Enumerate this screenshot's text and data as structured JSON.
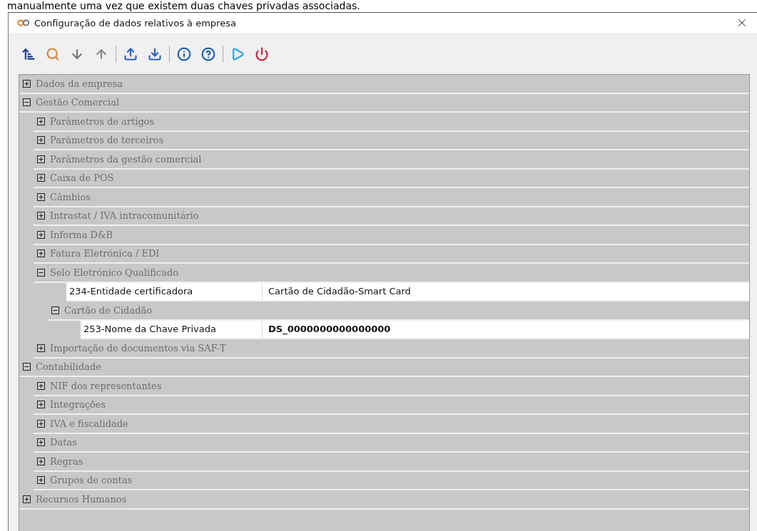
{
  "caption": "manualmente uma vez que existem duas chaves privadas associadas.",
  "window": {
    "title": "Configuração de dados relativos à empresa"
  },
  "toolbar": [
    {
      "kind": "sort"
    },
    {
      "kind": "search"
    },
    {
      "kind": "down"
    },
    {
      "kind": "up"
    },
    {
      "kind": "separator"
    },
    {
      "kind": "export"
    },
    {
      "kind": "import"
    },
    {
      "kind": "separator"
    },
    {
      "kind": "info"
    },
    {
      "kind": "help"
    },
    {
      "kind": "separator"
    },
    {
      "kind": "run"
    },
    {
      "kind": "power"
    }
  ],
  "tree": [
    {
      "kind": "group",
      "label": "Dados da empresa",
      "expanded": false
    },
    {
      "kind": "group",
      "label": "Gestão Comercial",
      "expanded": true,
      "children": [
        {
          "kind": "group",
          "label": "Parâmetros de artigos",
          "expanded": false
        },
        {
          "kind": "group",
          "label": "Parâmetros de terceiros",
          "expanded": false
        },
        {
          "kind": "group",
          "label": "Parâmetros da gestão comercial",
          "expanded": false
        },
        {
          "kind": "group",
          "label": "Caixa de POS",
          "expanded": false
        },
        {
          "kind": "group",
          "label": "Câmbios",
          "expanded": false
        },
        {
          "kind": "group",
          "label": "Intrastat / IVA intracomunitário",
          "expanded": false
        },
        {
          "kind": "group",
          "label": "Informa D&B",
          "expanded": false
        },
        {
          "kind": "group",
          "label": "Fatura Eletrónica / EDI",
          "expanded": false
        },
        {
          "kind": "group",
          "label": "Selo Eletrónico Qualificado",
          "expanded": true,
          "children": [
            {
              "kind": "property",
              "label": "234-Entidade certificadora",
              "value": "Cartão de Cidadão-Smart Card",
              "emphasis": false
            },
            {
              "kind": "group",
              "label": "Cartão de Cidadão",
              "expanded": true,
              "children": [
                {
                  "kind": "property",
                  "label": "253-Nome da Chave Privada",
                  "value": "DS_0000000000000000",
                  "emphasis": true
                }
              ]
            }
          ]
        },
        {
          "kind": "group",
          "label": "Importação de documentos via SAF-T",
          "expanded": false
        }
      ]
    },
    {
      "kind": "group",
      "label": "Contabilidade",
      "expanded": true,
      "children": [
        {
          "kind": "group",
          "label": "NIF dos representantes",
          "expanded": false
        },
        {
          "kind": "group",
          "label": "Integrações",
          "expanded": false
        },
        {
          "kind": "group",
          "label": "IVA e fiscalidade",
          "expanded": false
        },
        {
          "kind": "group",
          "label": "Datas",
          "expanded": false
        },
        {
          "kind": "group",
          "label": "Regras",
          "expanded": false
        },
        {
          "kind": "group",
          "label": "Grupos de contas",
          "expanded": false
        }
      ]
    },
    {
      "kind": "group",
      "label": "Recursos Humanos",
      "expanded": false
    }
  ]
}
